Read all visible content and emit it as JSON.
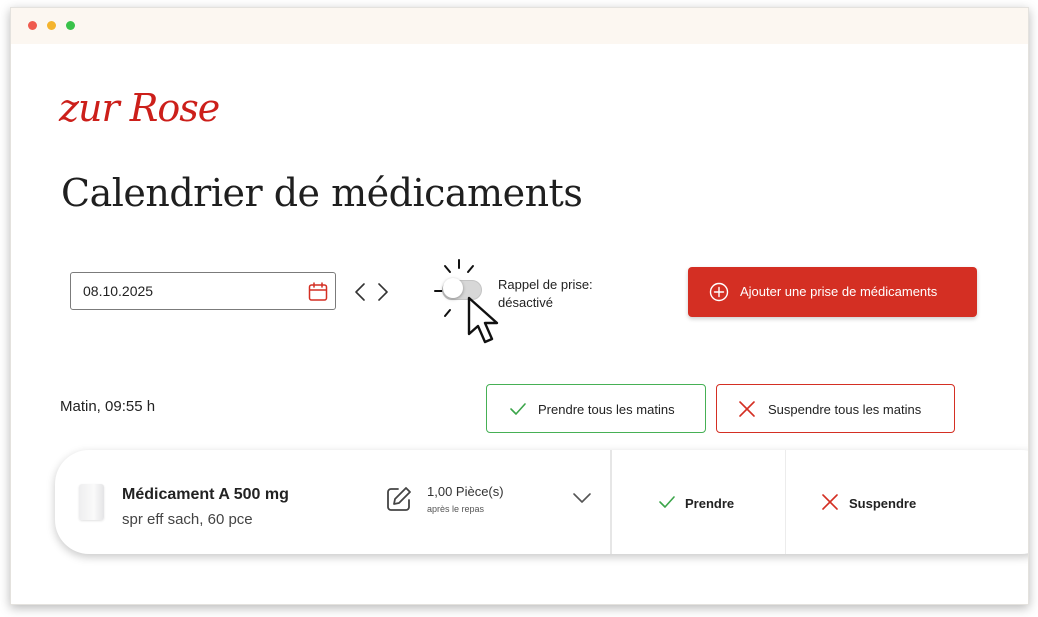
{
  "brand": {
    "logo_text": "zur Rose",
    "accent_color": "#d42f23"
  },
  "window": {
    "controls": [
      "close",
      "minimize",
      "maximize"
    ]
  },
  "page": {
    "title": "Calendrier de médicaments"
  },
  "date_picker": {
    "value": "08.10.2025",
    "icon": "calendar-icon"
  },
  "navigation": {
    "prev_icon": "chevron-left-icon",
    "next_icon": "chevron-right-icon"
  },
  "reminder": {
    "label": "Rappel de prise:",
    "state": "désactivé",
    "enabled": false
  },
  "add_button": {
    "label": "Ajouter une prise de médicaments",
    "icon": "plus-circle-icon"
  },
  "morning_section": {
    "label": "Matin, 09:55 h",
    "take_all_label": "Prendre tous les matins",
    "skip_all_label": "Suspendre tous les matins"
  },
  "medications": [
    {
      "name": "Médicament A 500 mg",
      "description": "spr eff sach, 60 pce",
      "quantity": "1,00 Pièce(s)",
      "note": "après le repas",
      "take_label": "Prendre",
      "skip_label": "Suspendre"
    }
  ],
  "colors": {
    "success": "#3ba54a",
    "danger": "#d42f23"
  }
}
